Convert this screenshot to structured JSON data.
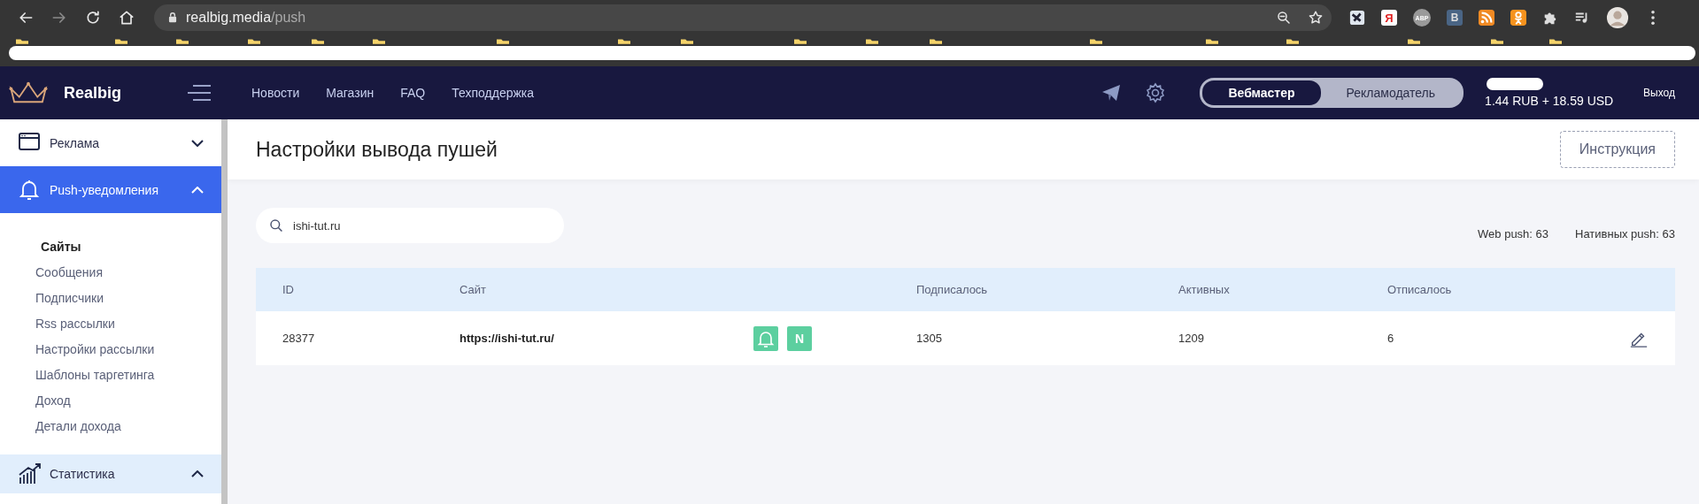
{
  "browser": {
    "url_host": "realbig.media",
    "url_path": "/push",
    "extensions": [
      {
        "kind": "tile"
      },
      {
        "kind": "ya",
        "label": "Я"
      },
      {
        "kind": "abp",
        "label": "ABP"
      },
      {
        "kind": "vk",
        "label": "B"
      },
      {
        "kind": "rss"
      },
      {
        "kind": "ok"
      },
      {
        "kind": "puzzle"
      },
      {
        "kind": "media"
      }
    ]
  },
  "header": {
    "logo": "Realbig",
    "nav": [
      "Новости",
      "Магазин",
      "FAQ",
      "Техподдержка"
    ],
    "roles": [
      {
        "label": "Вебмастер",
        "selected": true
      },
      {
        "label": "Рекламодатель",
        "selected": false
      }
    ],
    "balance": "1.44 RUB + 18.59 USD",
    "logout": "Выход"
  },
  "sidebar": {
    "sections": [
      {
        "kind": "ads",
        "label": "Реклама",
        "expanded": false,
        "selected": false
      },
      {
        "kind": "bell",
        "label": "Push-уведомления",
        "expanded": true,
        "selected": true,
        "children": [
          {
            "label": "Сайты",
            "selected": true
          },
          {
            "label": "Сообщения",
            "selected": false
          },
          {
            "label": "Подписчики",
            "selected": false
          },
          {
            "label": "Rss рассылки",
            "selected": false
          },
          {
            "label": "Настройки рассылки",
            "selected": false
          },
          {
            "label": "Шаблоны таргетинга",
            "selected": false
          },
          {
            "label": "Доход",
            "selected": false
          },
          {
            "label": "Детали дохода",
            "selected": false
          }
        ]
      },
      {
        "kind": "chart",
        "label": "Статистика",
        "expanded": true,
        "selected": false
      }
    ]
  },
  "page": {
    "title": "Настройки вывода пушей",
    "instruction_button": "Инструкция",
    "search": {
      "value": "ishi-tut.ru"
    },
    "counters": [
      "Web push: 63",
      "Нативных push: 63"
    ],
    "table": {
      "columns": [
        "ID",
        "Сайт",
        "",
        "Подписалось",
        "Активных",
        "Отписалось"
      ],
      "rows": [
        {
          "id": "28377",
          "site": "https://ishi-tut.ru/",
          "badges": [
            {
              "kind": "bell"
            },
            {
              "kind": "letter",
              "label": "N"
            }
          ],
          "subscribed": "1305",
          "active": "1209",
          "unsubscribed": "6"
        }
      ]
    }
  }
}
